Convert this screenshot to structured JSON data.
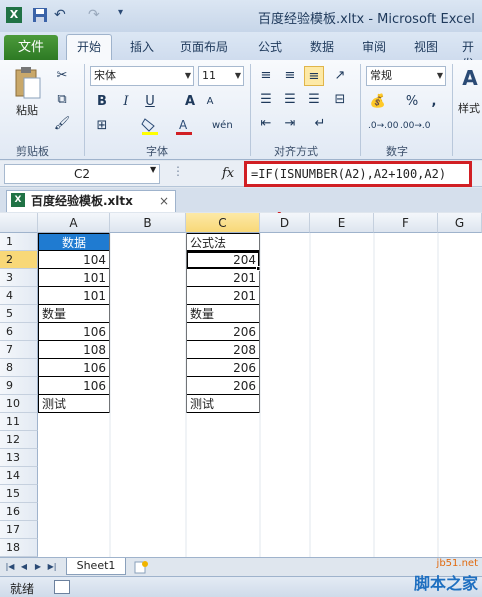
{
  "title": "百度经验模板.xltx - Microsoft Excel",
  "ribbon_tabs": {
    "file": "文件",
    "items": [
      "开始",
      "插入",
      "页面布局",
      "公式",
      "数据",
      "审阅",
      "视图",
      "开发"
    ]
  },
  "ribbon": {
    "paste_label": "粘贴",
    "font_name": "宋体",
    "font_size": "11",
    "number_format": "常规",
    "groups": [
      "剪贴板",
      "字体",
      "对齐方式",
      "数字"
    ],
    "style_label": "样式",
    "bold": "B",
    "italic": "I",
    "underline": "U",
    "percent": "%",
    "comma": ","
  },
  "formula_bar": {
    "name_box": "C2",
    "fx": "fx",
    "formula": "=IF(ISNUMBER(A2),A2+100,A2)"
  },
  "doc_tab": {
    "name": "百度经验模板.xltx",
    "close": "×"
  },
  "grid": {
    "columns": [
      "A",
      "B",
      "C",
      "D",
      "E",
      "F",
      "G"
    ],
    "rows": [
      "1",
      "2",
      "3",
      "4",
      "5",
      "6",
      "7",
      "8",
      "9",
      "10",
      "11",
      "12",
      "13",
      "14",
      "15",
      "16",
      "17",
      "18"
    ],
    "col_a": [
      "数据",
      "104",
      "101",
      "101",
      "数量",
      "106",
      "108",
      "106",
      "106",
      "测试"
    ],
    "col_c": [
      "公式法",
      "204",
      "201",
      "201",
      "数量",
      "206",
      "208",
      "206",
      "206",
      "测试"
    ]
  },
  "sheet_tab": "Sheet1",
  "status": "就绪",
  "watermark": {
    "site": "jb51.net",
    "brand": "脚本之家"
  },
  "colors": {
    "accent_red": "#d11f24",
    "header_blue": "#1f7bd1",
    "file_green": "#2d7a24"
  }
}
